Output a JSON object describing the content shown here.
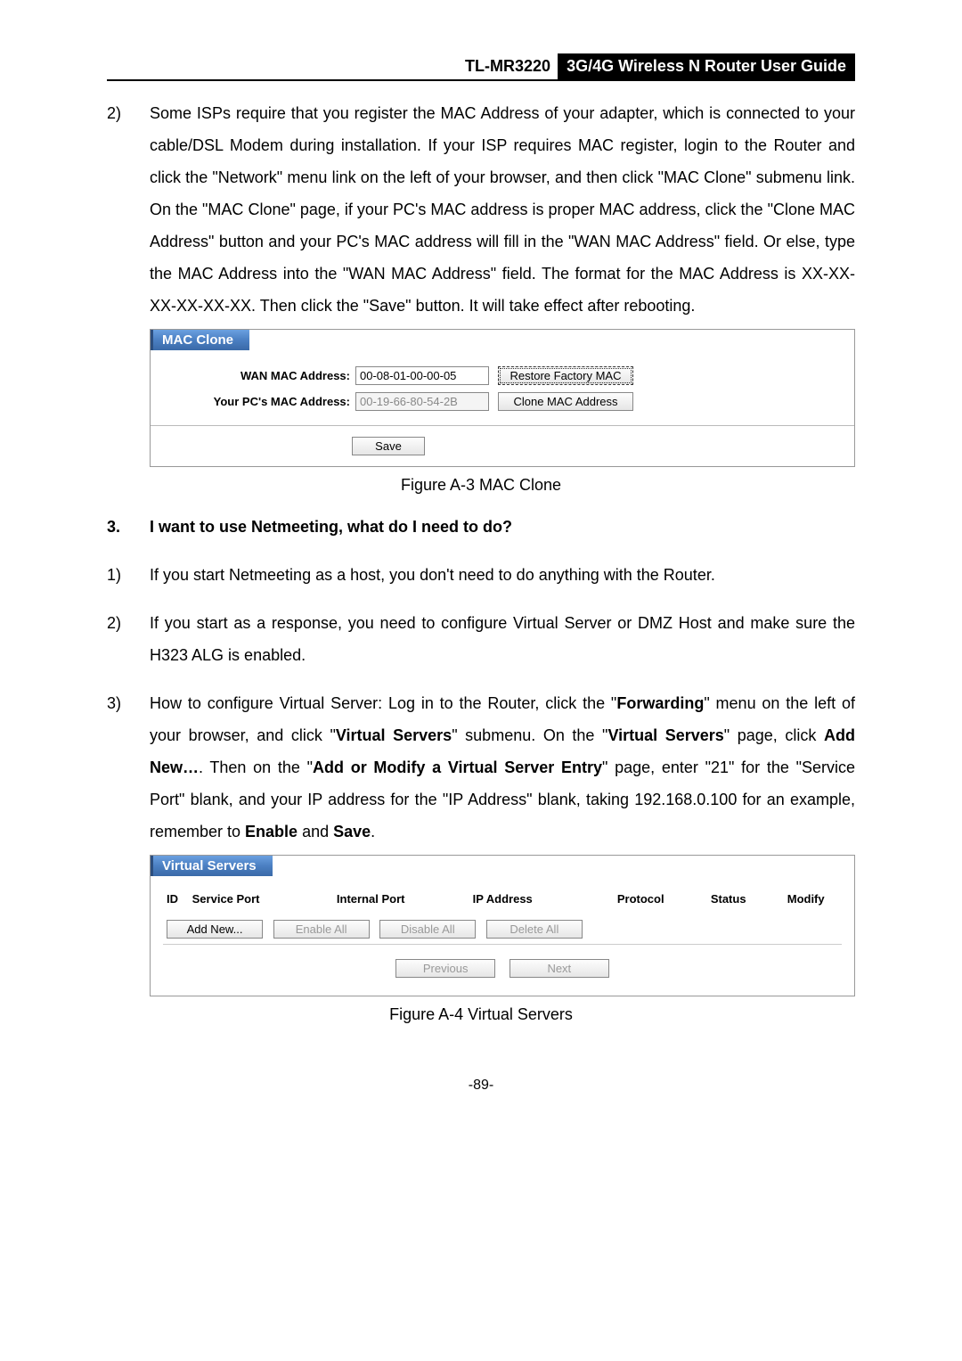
{
  "header": {
    "model": "TL-MR3220",
    "guide": "3G/4G Wireless N Router User Guide"
  },
  "para2": {
    "num": "2)",
    "text": "Some ISPs require that you register the MAC Address of your adapter, which is connected to your cable/DSL Modem during installation. If your ISP requires MAC register, login to the Router and click the \"Network\" menu link on the left of your browser, and then click \"MAC Clone\" submenu link. On the \"MAC Clone\" page, if your PC's MAC address is proper MAC address, click the \"Clone MAC Address\" button and your PC's MAC address will fill in the \"WAN MAC Address\" field. Or else, type the MAC Address into the \"WAN MAC Address\" field. The format for the MAC Address is XX-XX-XX-XX-XX-XX. Then click the \"Save\" button. It will take effect after rebooting."
  },
  "macClone": {
    "title": "MAC Clone",
    "wanLabel": "WAN MAC Address:",
    "wanValue": "00-08-01-00-00-05",
    "restoreBtn": "Restore Factory MAC",
    "pcLabel": "Your PC's MAC Address:",
    "pcValue": "00-19-66-80-54-2B",
    "cloneBtn": "Clone MAC Address",
    "saveBtn": "Save",
    "caption": "Figure A-3 MAC Clone"
  },
  "q3": {
    "num": "3.",
    "text": "I want to use Netmeeting, what do I need to do?"
  },
  "a3_1": {
    "num": "1)",
    "text": "If you start Netmeeting as a host, you don't need to do anything with the Router."
  },
  "a3_2": {
    "num": "2)",
    "text": "If you start as a response, you need to configure Virtual Server or DMZ Host and make sure the H323 ALG is enabled."
  },
  "a3_3": {
    "num": "3)",
    "pre": "How to configure Virtual Server: Log in to the Router, click the \"",
    "b1": "Forwarding",
    "mid1": "\" menu on the left of your browser, and click \"",
    "b2": "Virtual Servers",
    "mid2": "\" submenu. On the \"",
    "b3": "Virtual Servers",
    "mid3": "\" page, click ",
    "b4": "Add New…",
    "mid4": ". Then on the \"",
    "b5": "Add or Modify a Virtual Server Entry",
    "mid5": "\" page, enter \"21\" for the \"Service Port\" blank, and your IP address for the \"IP Address\" blank, taking 192.168.0.100 for an example, remember to ",
    "b6": "Enable",
    "mid6": " and ",
    "b7": "Save",
    "post": "."
  },
  "vs": {
    "title": "Virtual Servers",
    "cols": {
      "id": "ID",
      "sp": "Service Port",
      "ip2": "Internal Port",
      "ipaddr": "IP Address",
      "proto": "Protocol",
      "status": "Status",
      "mod": "Modify"
    },
    "addNew": "Add New...",
    "enableAll": "Enable All",
    "disableAll": "Disable All",
    "deleteAll": "Delete All",
    "prev": "Previous",
    "next": "Next",
    "caption": "Figure A-4 Virtual Servers"
  },
  "pageNum": "-89-"
}
